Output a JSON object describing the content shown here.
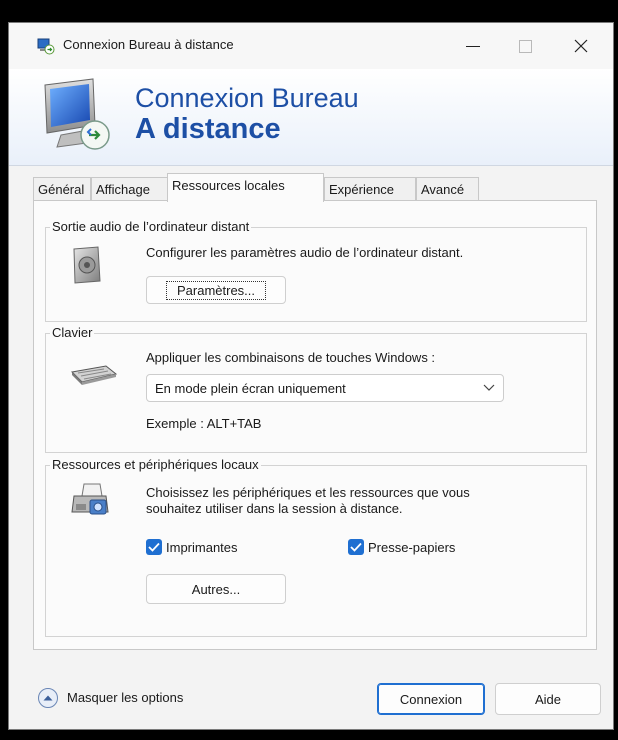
{
  "window": {
    "title": "Connexion Bureau à distance"
  },
  "banner": {
    "line1": "Connexion Bureau",
    "line2": "A distance"
  },
  "tabs": [
    {
      "label": "Général",
      "active": false
    },
    {
      "label": "Affichage",
      "active": false
    },
    {
      "label": "Ressources locales",
      "active": true
    },
    {
      "label": "Expérience",
      "active": false
    },
    {
      "label": "Avancé",
      "active": false
    }
  ],
  "audio": {
    "group_label": "Sortie audio de l’ordinateur distant",
    "description": "Configurer les paramètres audio de l’ordinateur distant.",
    "button_label": "Paramètres...",
    "icon": "speaker-icon"
  },
  "keyboard": {
    "group_label": "Clavier",
    "description": "Appliquer les combinaisons de touches Windows :",
    "select_value": "En mode plein écran uniquement",
    "example": "Exemple : ALT+TAB",
    "icon": "keyboard-icon"
  },
  "resources": {
    "group_label": "Ressources et périphériques locaux",
    "description_line1": "Choisissez les périphériques et les ressources que vous",
    "description_line2": "souhaitez utiliser dans la session à distance.",
    "printers_label": "Imprimantes",
    "printers_checked": true,
    "clipboard_label": "Presse-papiers",
    "clipboard_checked": true,
    "more_button_label": "Autres...",
    "icon": "devices-icon"
  },
  "footer": {
    "toggle_label": "Masquer les options",
    "connect_label": "Connexion",
    "help_label": "Aide"
  },
  "colors": {
    "accent": "#1f6fd1",
    "banner_text": "#1d4fa5"
  }
}
